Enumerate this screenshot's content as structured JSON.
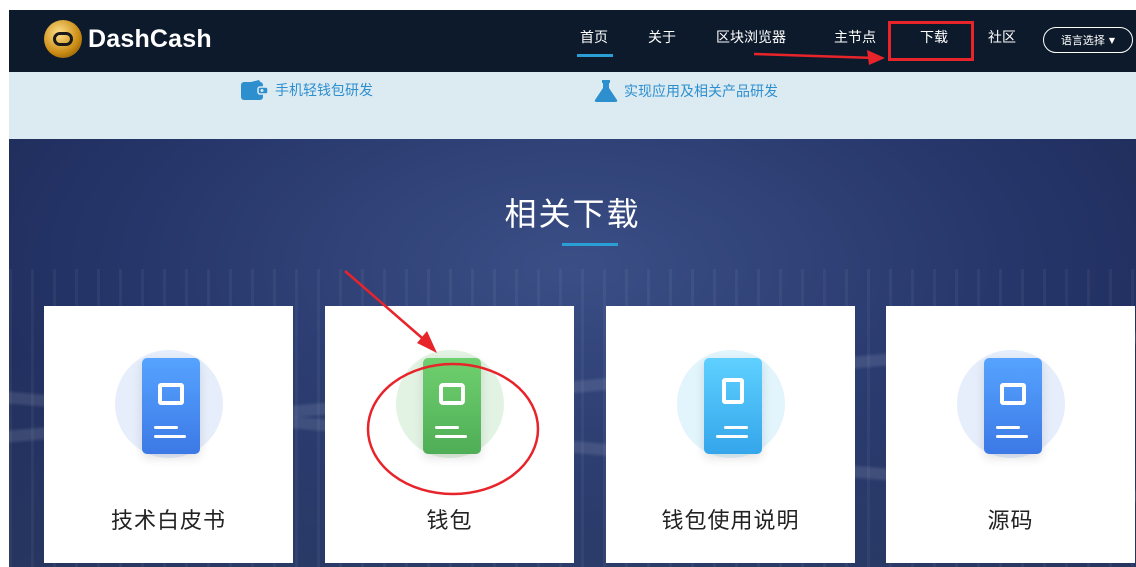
{
  "brand": {
    "name": "DashCash"
  },
  "nav": {
    "items": [
      "首页",
      "关于",
      "区块浏览器",
      "主节点",
      "下载",
      "社区"
    ],
    "language_button": "语言选择"
  },
  "features": [
    {
      "icon": "wallet-icon",
      "label": "手机轻钱包研发"
    },
    {
      "icon": "flask-icon",
      "label": "实现应用及相关产品研发"
    }
  ],
  "hero": {
    "title": "相关下载"
  },
  "cards": [
    {
      "icon": "book-icon",
      "label": "技术白皮书",
      "color": "#4a8ff0"
    },
    {
      "icon": "wallet-icon",
      "label": "钱包",
      "color": "#5cbf63"
    },
    {
      "icon": "bookmark-book-icon",
      "label": "钱包使用说明",
      "color": "#3fb5ef"
    },
    {
      "icon": "book-icon",
      "label": "源码",
      "color": "#4a8ff0"
    }
  ],
  "colors": {
    "nav_bg": "#0d1a2b",
    "accent": "#2a9fd6",
    "annotation": "#e8242b"
  }
}
